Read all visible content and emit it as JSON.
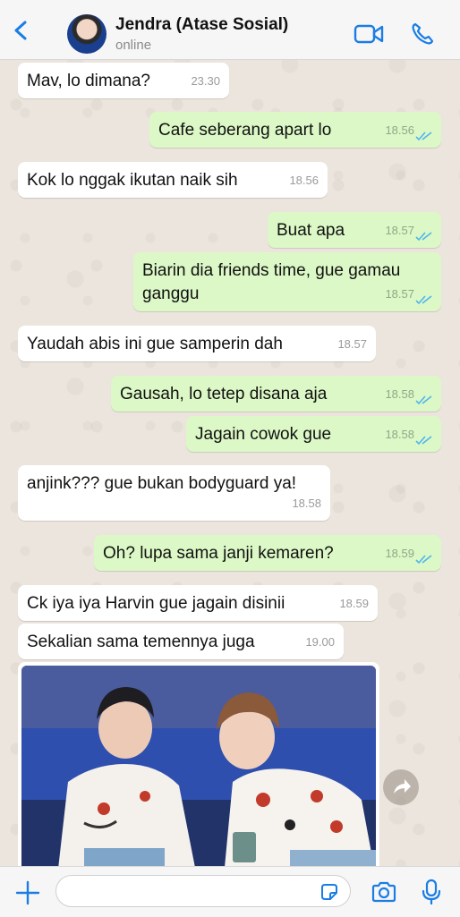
{
  "header": {
    "contact_name": "Jendra (Atase Sosial)",
    "status": "online"
  },
  "messages": [
    {
      "direction": "in",
      "text": "Mav, lo dimana?",
      "time": "23.30"
    },
    {
      "direction": "out",
      "text": "Cafe seberang apart lo",
      "time": "18.56"
    },
    {
      "direction": "in",
      "text": "Kok lo nggak ikutan naik sih",
      "time": "18.56"
    },
    {
      "direction": "out",
      "text": "Buat apa",
      "time": "18.57"
    },
    {
      "direction": "out",
      "text": "Biarin dia friends time, gue gamau ganggu",
      "time": "18.57"
    },
    {
      "direction": "in",
      "text": "Yaudah abis ini gue samperin dah",
      "time": "18.57"
    },
    {
      "direction": "out",
      "text": "Gausah, lo tetep disana aja",
      "time": "18.58"
    },
    {
      "direction": "out",
      "text": "Jagain cowok gue",
      "time": "18.58"
    },
    {
      "direction": "in",
      "text": "anjink??? gue bukan bodyguard ya!",
      "time": "18.58"
    },
    {
      "direction": "out",
      "text": "Oh? lupa sama janji kemaren?",
      "time": "18.59"
    },
    {
      "direction": "in",
      "text": "Ck iya iya Harvin gue jagain disinii",
      "time": "18.59"
    },
    {
      "direction": "in",
      "text": "Sekalian sama temennya juga",
      "time": "19.00"
    }
  ],
  "input": {
    "placeholder": ""
  },
  "colors": {
    "accent": "#1a7de3",
    "outgoing_bubble": "#dcf8c6",
    "incoming_bubble": "#ffffff",
    "read_ticks": "#4fb6ec"
  }
}
